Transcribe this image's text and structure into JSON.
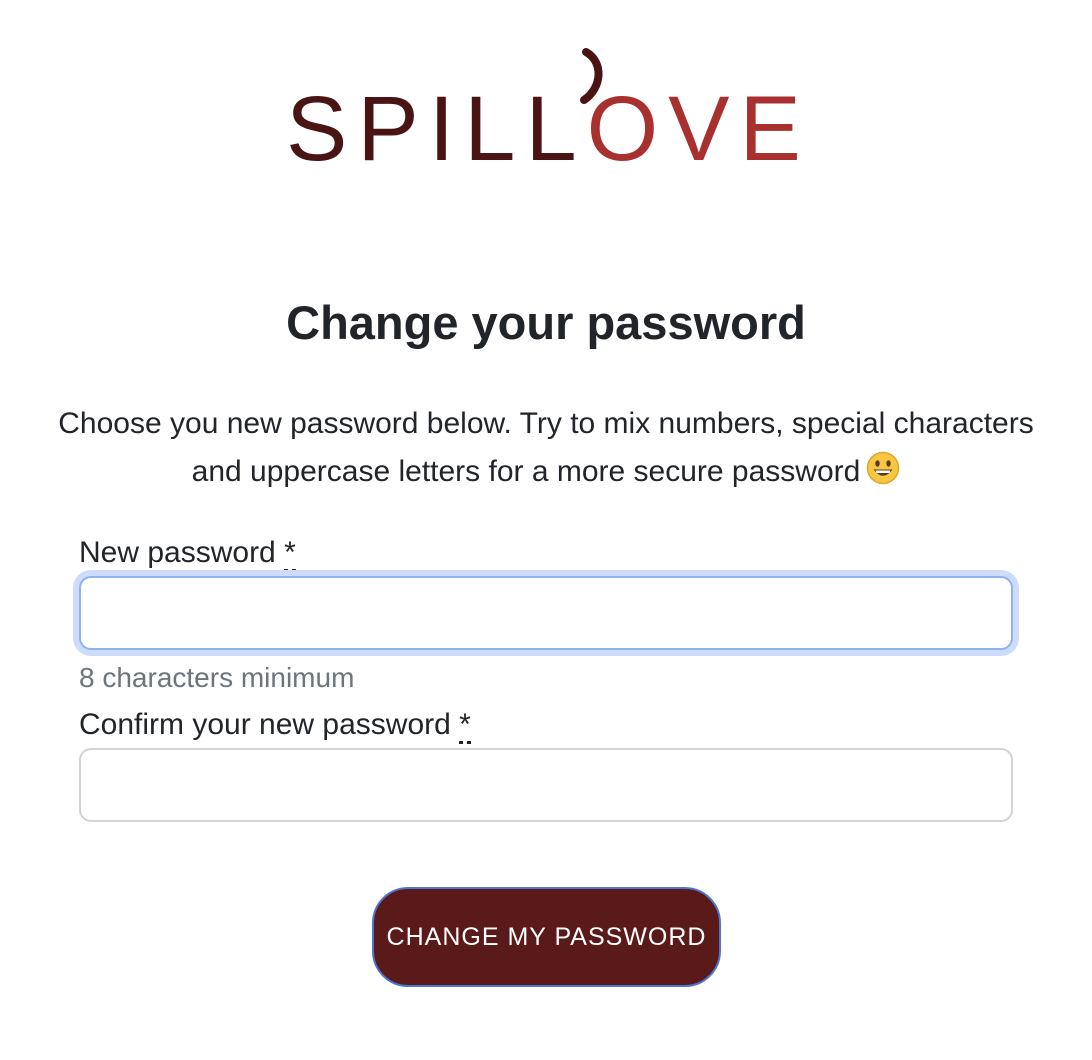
{
  "brand": {
    "logo_text": "SPILLOVER",
    "dark_color": "#4a1414",
    "accent_color": "#a8302f"
  },
  "page": {
    "title": "Change your password",
    "intro": "Choose you new password below. Try to mix numbers, special characters and uppercase letters for a more secure password",
    "intro_emoji": "grinning-face-icon"
  },
  "form": {
    "new_password": {
      "label": "New password",
      "required_mark": "*",
      "required_title": "required",
      "value": "",
      "help": "8 characters minimum"
    },
    "confirm_password": {
      "label": "Confirm your new password",
      "required_mark": "*",
      "required_title": "required",
      "value": ""
    },
    "submit_label": "CHANGE MY PASSWORD",
    "submit_color": "#5a1a1a"
  }
}
